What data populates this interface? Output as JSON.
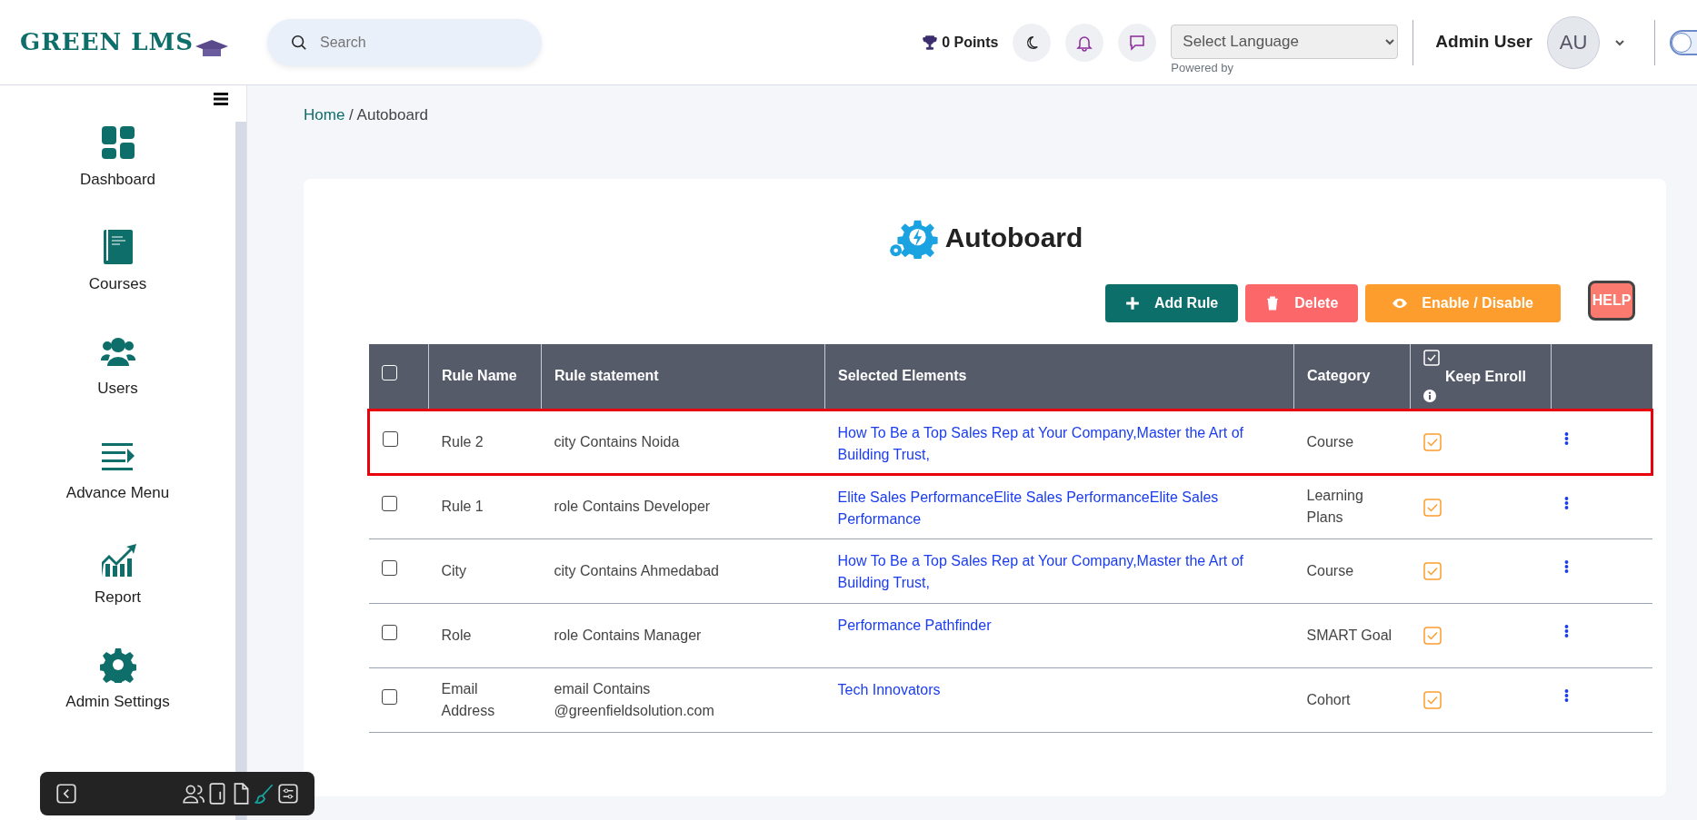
{
  "header": {
    "logo": "GREEN LMS",
    "search": {
      "placeholder": "Search"
    },
    "points": "0 Points",
    "language": {
      "placeholder": "Select Language",
      "note": "Powered by"
    },
    "user": {
      "name": "Admin User",
      "initials": "AU"
    },
    "toggle": {
      "on": false
    }
  },
  "sidebar": {
    "items": [
      {
        "label": "Dashboard"
      },
      {
        "label": "Courses"
      },
      {
        "label": "Users"
      },
      {
        "label": "Advance Menu"
      },
      {
        "label": "Report"
      },
      {
        "label": "Admin Settings"
      }
    ]
  },
  "toolbar": [
    {
      "active": false
    },
    {
      "active": false
    },
    {
      "active": false
    },
    {
      "active": false
    },
    {
      "active": true
    },
    {
      "active": false
    }
  ],
  "breadcrumb": {
    "home": "Home",
    "current": "/ Autoboard"
  },
  "page_title": "Autoboard",
  "buttons": [
    {
      "label": "Add Rule",
      "kind": "add"
    },
    {
      "label": "Delete",
      "kind": "delete"
    },
    {
      "label": "Enable / Disable",
      "kind": "toggle"
    }
  ],
  "help": "HELP",
  "table": {
    "select_all": false,
    "columns": [
      {
        "label": "Rule Name"
      },
      {
        "label": "Rule statement"
      },
      {
        "label": "Selected Elements"
      },
      {
        "label": "Category"
      },
      {
        "label": "Keep Enroll",
        "checked": true
      }
    ],
    "rows": [
      {
        "selected": false,
        "highlighted": true,
        "rule_name": "Rule 2",
        "rule_statement": "city Contains Noida",
        "selected_elements": "How To Be a Top Sales Rep at Your Company,Master the Art of Building Trust,",
        "category": "Course",
        "keep_enroll": true
      },
      {
        "selected": false,
        "highlighted": false,
        "rule_name": "Rule 1",
        "rule_statement": "role Contains Developer",
        "selected_elements": "Elite Sales PerformanceElite Sales PerformanceElite Sales Performance",
        "category": "Learning Plans",
        "keep_enroll": true
      },
      {
        "selected": false,
        "highlighted": false,
        "rule_name": "City",
        "rule_statement": "city Contains Ahmedabad",
        "selected_elements": "How To Be a Top Sales Rep at Your Company,Master the Art of Building Trust,",
        "category": "Course",
        "keep_enroll": true
      },
      {
        "selected": false,
        "highlighted": false,
        "rule_name": "Role",
        "rule_statement": "role Contains Manager",
        "selected_elements": "Performance Pathfinder",
        "category": "SMART Goal",
        "keep_enroll": true
      },
      {
        "selected": false,
        "highlighted": false,
        "rule_name": "Email Address",
        "rule_statement": "email Contains @greenfieldsolution.com",
        "selected_elements": "Tech Innovators",
        "category": "Cohort",
        "keep_enroll": true
      }
    ]
  }
}
